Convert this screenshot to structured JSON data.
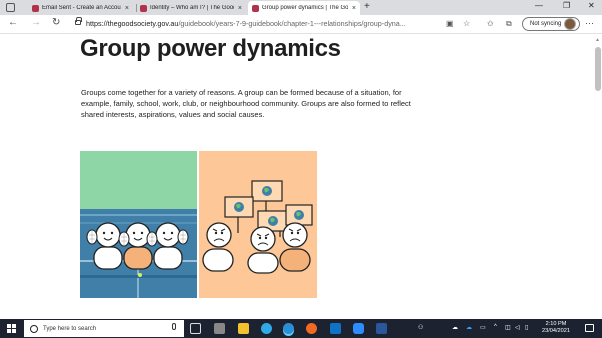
{
  "browser": {
    "tabs": [
      {
        "label": "Email Sent - Create an Account | T",
        "close": "×"
      },
      {
        "label": "Identity – Who am I? | The Good",
        "close": "×"
      },
      {
        "label": "Group power dynamics | The Go",
        "close": "×"
      }
    ],
    "new_tab": "+",
    "window_controls": {
      "minimize": "—",
      "restore": "❐",
      "close": "✕"
    },
    "url_host": "https://thegoodsociety.gov.au",
    "url_path": "/guidebook/years-7-9-guidebook/chapter-1---relationships/group-dyna...",
    "sync_label": "Not syncing",
    "menu": "···",
    "nav": {
      "back": "←",
      "forward": "→",
      "refresh": "↻"
    }
  },
  "page": {
    "title": "Group power dynamics",
    "intro": "Groups come together for a variety of reasons. A group can be formed because of a situation, for example, family, school, work, club, or neighbourhood community. Groups are also formed to reflect shared interests, aspirations, values and social causes.",
    "illustration_colors": {
      "left_sky": "#8fd6a6",
      "left_court": "#3f7fa8",
      "right_bg": "#fdc797"
    }
  },
  "taskbar": {
    "search_placeholder": "Type here to search",
    "time": "2:10 PM",
    "date": "23/04/2021"
  }
}
